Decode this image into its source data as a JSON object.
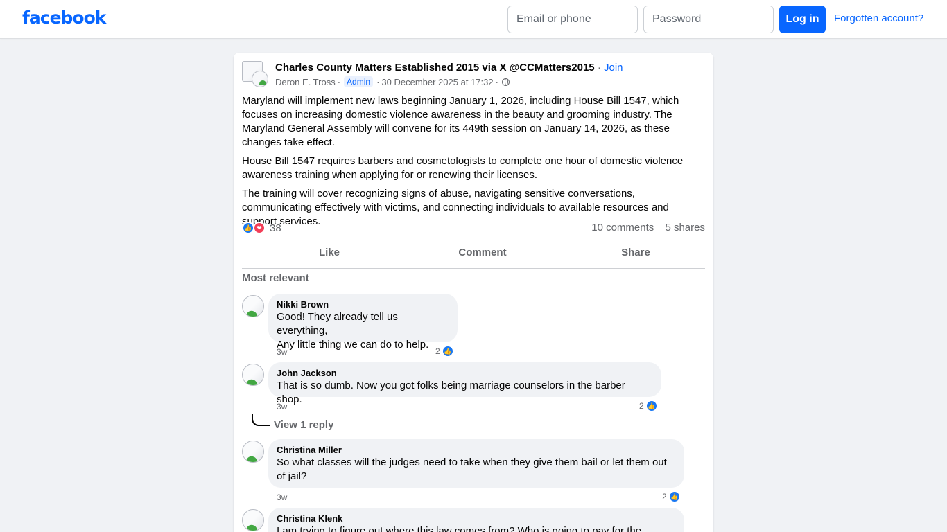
{
  "header": {
    "logo": "facebook",
    "email_placeholder": "Email or phone",
    "password_placeholder": "Password",
    "login_label": "Log in",
    "forgot_label": "Forgotten account?"
  },
  "post": {
    "group_name": "Charles County Matters Established 2015 via X @CCMatters2015",
    "join_label": "Join",
    "author": "Deron E. Tross",
    "role_badge": "Admin",
    "timestamp": "30 December 2025 at 17:32",
    "paragraphs": [
      "Maryland will implement new laws beginning January 1, 2026, including House Bill 1547, which focuses on increasing domestic violence awareness in the beauty and grooming industry. The Maryland General Assembly will convene for its 449th session on January 14, 2026, as these changes take effect.",
      "House Bill 1547 requires barbers and cosmetologists to complete one hour of domestic violence awareness training when applying for or renewing their licenses.",
      "The training will cover recognizing signs of abuse, navigating sensitive conversations, communicating effectively with victims, and connecting individuals to available resources and support services."
    ],
    "reaction_count": "38",
    "comments_count": "10 comments",
    "shares_count": "5 shares",
    "actions": {
      "like": "Like",
      "comment": "Comment",
      "share": "Share"
    },
    "sort_label": "Most relevant"
  },
  "comments": [
    {
      "name": "Nikki Brown",
      "lines": [
        "Good! They already tell us everything,",
        "Any little thing we can do to help."
      ],
      "time": "3w",
      "likes": "2"
    },
    {
      "name": "John Jackson",
      "lines": [
        "That is so dumb. Now you got folks being marriage counselors in the barber shop."
      ],
      "time": "3w",
      "likes": "2"
    },
    {
      "name": "Christina Miller",
      "lines": [
        "So what classes will the judges need to take when they give them bail or let them out",
        "of jail?"
      ],
      "time": "3w",
      "likes": "2"
    },
    {
      "name": "Christina Klenk",
      "lines": [
        "I am trying to figure out where this law comes from? Who is going to pay for the"
      ],
      "time": "",
      "likes": ""
    }
  ],
  "view_reply_label": "View 1 reply",
  "colors": {
    "brand": "#0866ff",
    "background": "#f0f2f5",
    "secondary_text": "#65676b"
  }
}
